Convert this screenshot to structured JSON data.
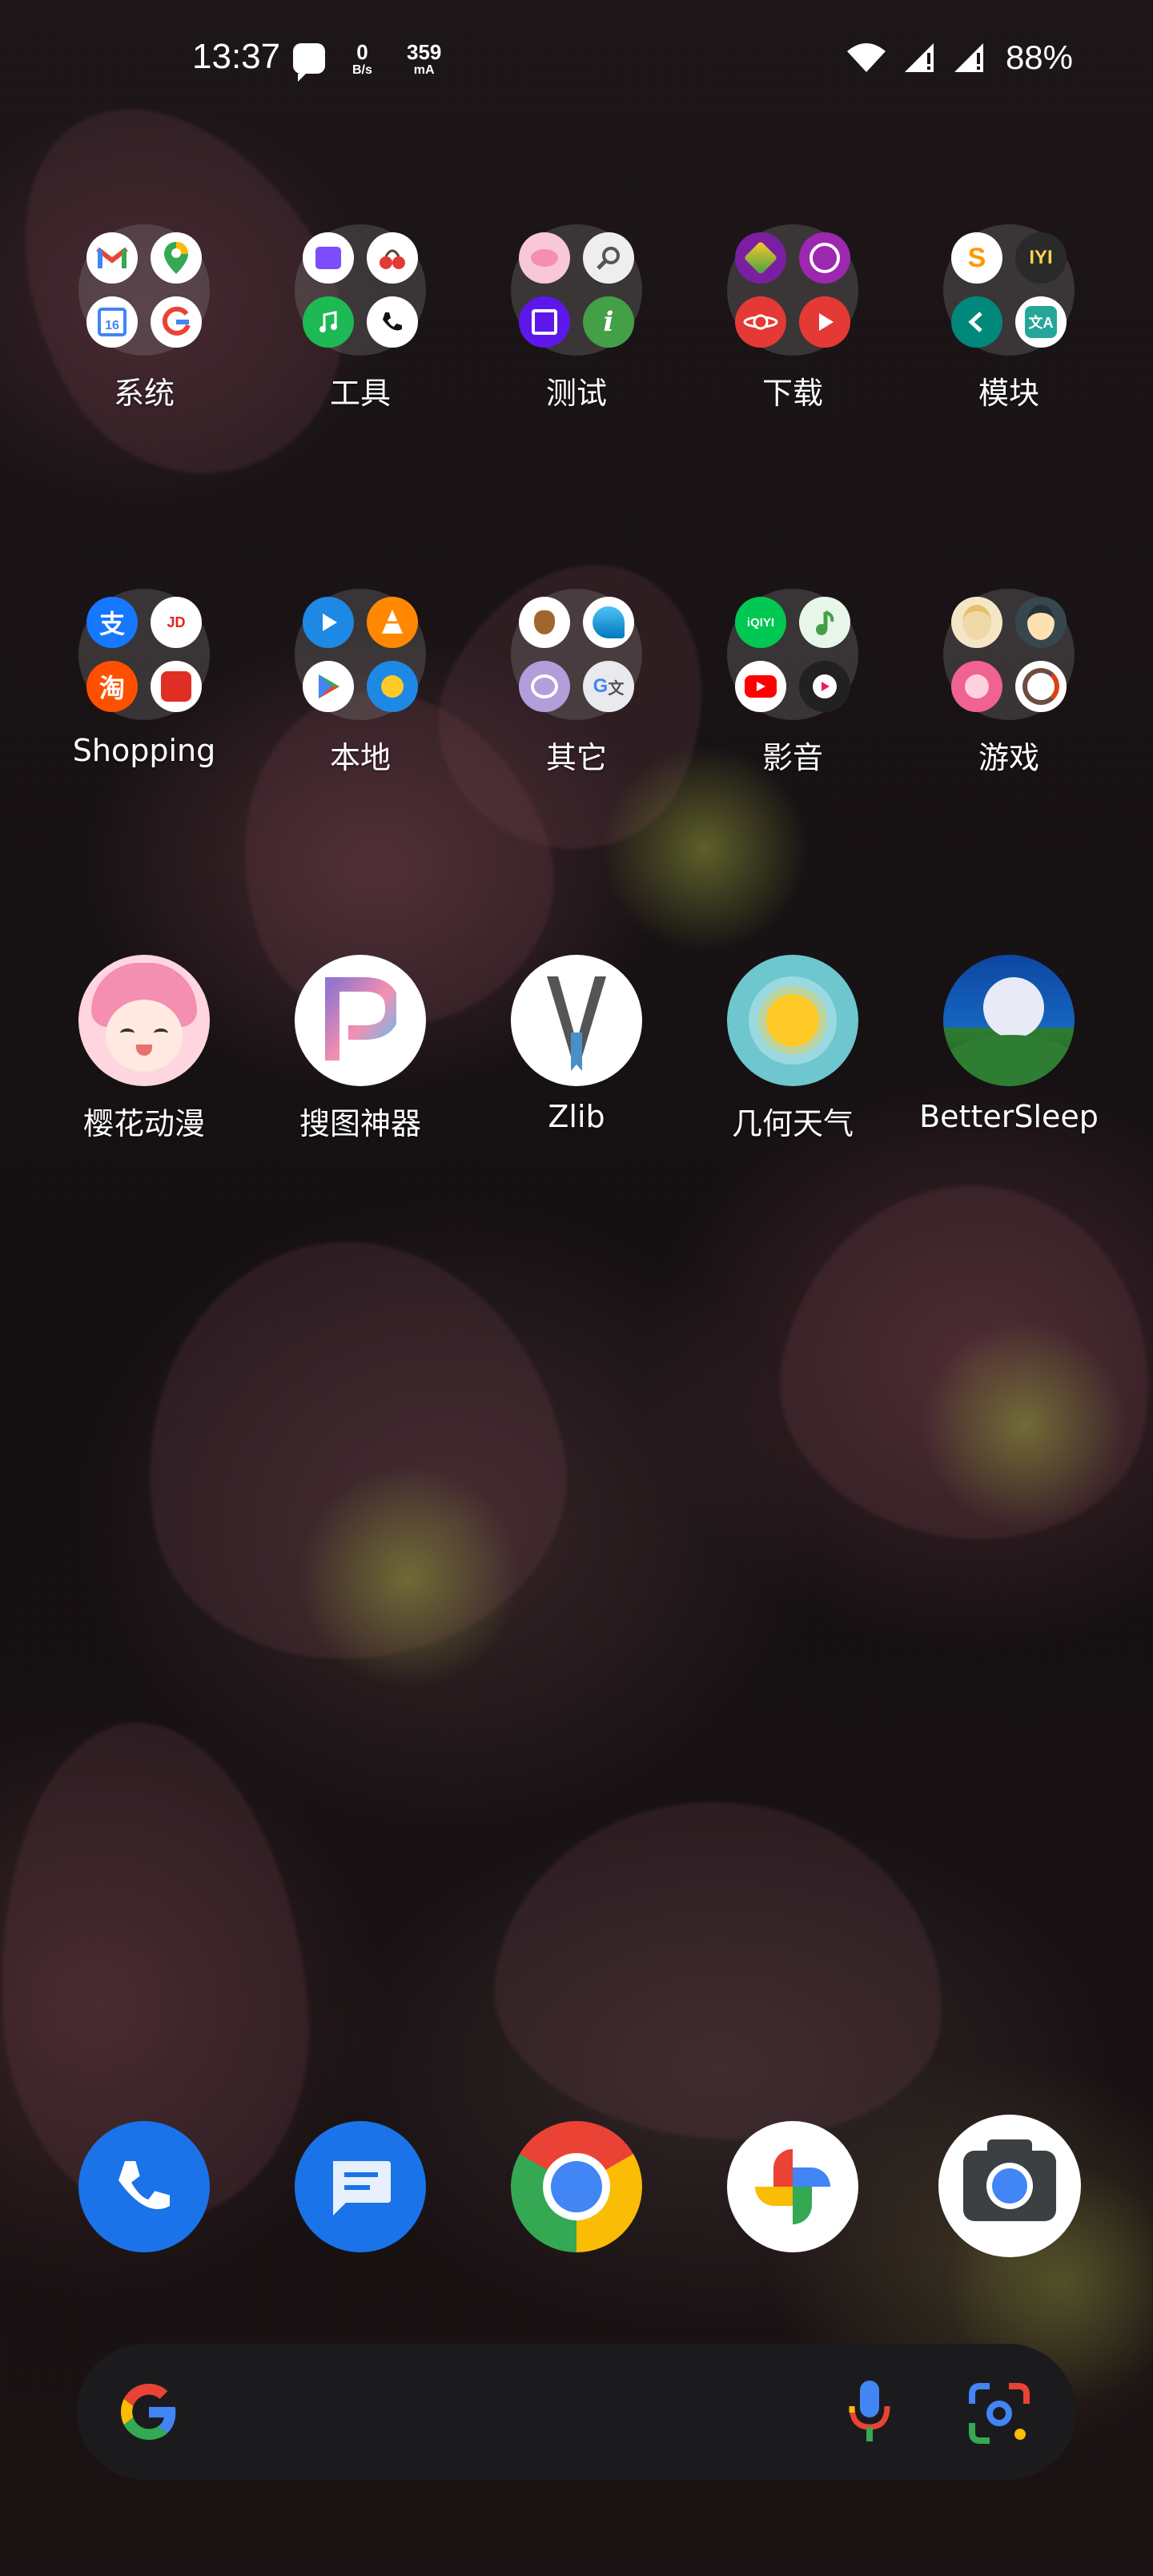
{
  "status_bar": {
    "time": "13:37",
    "net_speed_value": "0",
    "net_speed_unit": "B/s",
    "current_value": "359",
    "current_unit": "mA",
    "battery": "88%",
    "icons": [
      "chat-notification-icon",
      "wifi-icon",
      "signal-icon",
      "signal-icon",
      "battery-text"
    ]
  },
  "folders_row1": [
    {
      "label": "系统",
      "icons": [
        "gmail-icon",
        "maps-icon",
        "calendar-icon",
        "google-icon"
      ]
    },
    {
      "label": "工具",
      "icons": [
        "file-manager-icon",
        "cherry-icon",
        "music-icon",
        "phone-call-icon"
      ]
    },
    {
      "label": "测试",
      "icons": [
        "pig-icon",
        "magnifier-icon",
        "chip-icon",
        "info-icon"
      ]
    },
    {
      "label": "下载",
      "icons": [
        "app-store-icon",
        "browser-icon",
        "saturn-icon",
        "play-red-icon"
      ]
    },
    {
      "label": "模块",
      "icons": [
        "s-logo-icon",
        "yi-logo-icon",
        "kdeconnect-icon",
        "translate-icon"
      ]
    }
  ],
  "folders_row2": [
    {
      "label": "Shopping",
      "icons": [
        "alipay-icon",
        "jd-icon",
        "taobao-icon",
        "pinduoduo-icon"
      ]
    },
    {
      "label": "本地",
      "icons": [
        "media-player-icon",
        "vlc-icon",
        "play-store-icon",
        "scanner-icon"
      ]
    },
    {
      "label": "其它",
      "icons": [
        "acorn-icon",
        "wave-icon",
        "notes-icon",
        "google-translate-icon"
      ]
    },
    {
      "label": "影音",
      "icons": [
        "iqiyi-icon",
        "music-note-icon",
        "youtube-icon",
        "video-player-icon"
      ]
    },
    {
      "label": "游戏",
      "icons": [
        "anime-girl-icon",
        "anime-boy-icon",
        "pink-character-icon",
        "swirl-icon"
      ]
    }
  ],
  "apps_row": [
    {
      "label": "樱花动漫",
      "icon": "sakura-anime-icon"
    },
    {
      "label": "搜图神器",
      "icon": "picture-search-icon"
    },
    {
      "label": "Zlib",
      "icon": "zlib-icon"
    },
    {
      "label": "几何天气",
      "icon": "weather-sun-icon"
    },
    {
      "label": "BetterSleep",
      "icon": "moon-icon"
    }
  ],
  "mini_icon_text": {
    "jd": "JD",
    "iqiyi": "iQIYI",
    "yi": "IYI",
    "translate_g": "G",
    "translate_wen": "文",
    "translate_a": "文A"
  },
  "dock": [
    {
      "icon": "phone-icon"
    },
    {
      "icon": "messages-icon"
    },
    {
      "icon": "chrome-icon"
    },
    {
      "icon": "photos-icon"
    },
    {
      "icon": "camera-icon"
    }
  ],
  "search_bar": {
    "left_icon": "google-g-icon",
    "mic_icon": "mic-icon",
    "lens_icon": "lens-icon"
  },
  "colors": {
    "google_blue": "#4285F4",
    "google_red": "#EA4335",
    "google_yellow": "#FBBC05",
    "google_green": "#34A853"
  }
}
